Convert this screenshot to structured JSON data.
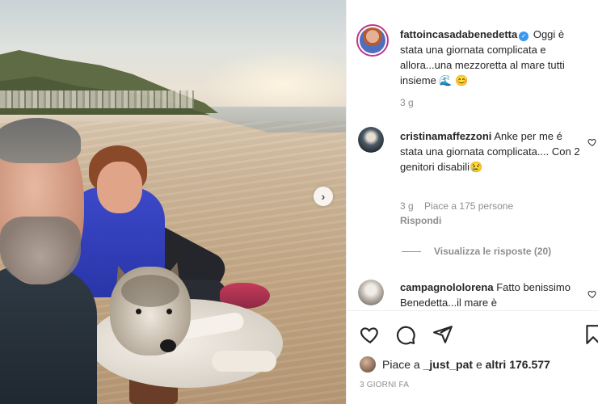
{
  "post": {
    "author": "fattoincasadabenedetta",
    "caption": "Oggi è stata una giornata complicata e allora...una mezzoretta al mare tutti insieme 🌊 😊",
    "caption_age": "3 g"
  },
  "comments": [
    {
      "username": "cristinamaffezzoni",
      "text": "Anke per me é stata una giornata complicata.... Con 2 genitori disabili😢",
      "age": "3 g",
      "likes": "Piace a 175 persone",
      "reply": "Rispondi"
    },
    {
      "username": "campagnololorena",
      "text": "Fatto benissimo Benedetta...il mare è"
    }
  ],
  "view_replies": "Visualizza le risposte (20)",
  "likes_line": {
    "prefix": "Piace a ",
    "user": "_just_pat",
    "middle": " e ",
    "others": "altri 176.577"
  },
  "time_ago": "3 GIORNI FA",
  "icons": [
    "heart-icon",
    "comment-icon",
    "share-icon",
    "bookmark-icon",
    "next-arrow-icon"
  ],
  "colors": {
    "accent": "#3897f0",
    "story_ring": "#c1358a",
    "text": "#262626",
    "muted": "#8e8e8e"
  }
}
